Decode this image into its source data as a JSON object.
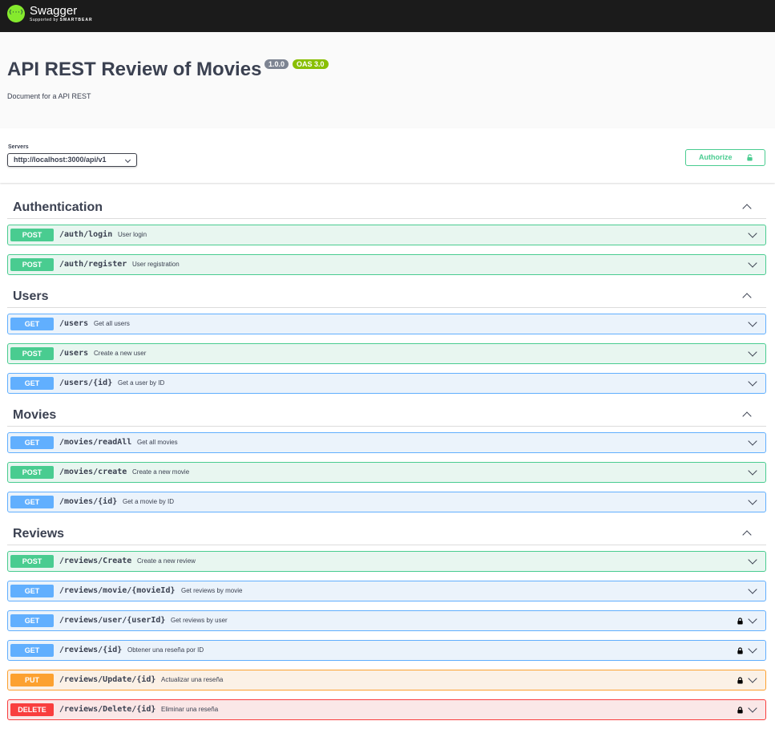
{
  "topbar": {
    "logo_title": "Swagger",
    "logo_sub_prefix": "Supported by",
    "logo_sub_brand": "SMARTBEAR",
    "logo_icon": "swagger-logo-icon"
  },
  "info": {
    "title": "API REST Review of Movies",
    "version": "1.0.0",
    "oas": "OAS 3.0",
    "description": "Document for a API REST"
  },
  "servers": {
    "label": "Servers",
    "selected": "http://localhost:3000/api/v1"
  },
  "authorize": {
    "label": "Authorize",
    "icon": "unlocked-icon"
  },
  "colors": {
    "post": "#49cc90",
    "get": "#61affe",
    "put": "#fca130",
    "delete": "#f93e3e"
  },
  "tags": [
    {
      "name": "Authentication",
      "operations": [
        {
          "method": "POST",
          "path": "/auth/login",
          "summary": "User login",
          "locked": false
        },
        {
          "method": "POST",
          "path": "/auth/register",
          "summary": "User registration",
          "locked": false
        }
      ]
    },
    {
      "name": "Users",
      "operations": [
        {
          "method": "GET",
          "path": "/users",
          "summary": "Get all users",
          "locked": false
        },
        {
          "method": "POST",
          "path": "/users",
          "summary": "Create a new user",
          "locked": false
        },
        {
          "method": "GET",
          "path": "/users/{id}",
          "summary": "Get a user by ID",
          "locked": false
        }
      ]
    },
    {
      "name": "Movies",
      "operations": [
        {
          "method": "GET",
          "path": "/movies/readAll",
          "summary": "Get all movies",
          "locked": false
        },
        {
          "method": "POST",
          "path": "/movies/create",
          "summary": "Create a new movie",
          "locked": false
        },
        {
          "method": "GET",
          "path": "/movies/{id}",
          "summary": "Get a movie by ID",
          "locked": false
        }
      ]
    },
    {
      "name": "Reviews",
      "operations": [
        {
          "method": "POST",
          "path": "/reviews/Create",
          "summary": "Create a new review",
          "locked": false
        },
        {
          "method": "GET",
          "path": "/reviews/movie/{movieId}",
          "summary": "Get reviews by movie",
          "locked": false
        },
        {
          "method": "GET",
          "path": "/reviews/user/{userId}",
          "summary": "Get reviews by user",
          "locked": true
        },
        {
          "method": "GET",
          "path": "/reviews/{id}",
          "summary": "Obtener una reseña por ID",
          "locked": true
        },
        {
          "method": "PUT",
          "path": "/reviews/Update/{id}",
          "summary": "Actualizar una reseña",
          "locked": true
        },
        {
          "method": "DELETE",
          "path": "/reviews/Delete/{id}",
          "summary": "Eliminar una reseña",
          "locked": true
        }
      ]
    }
  ]
}
